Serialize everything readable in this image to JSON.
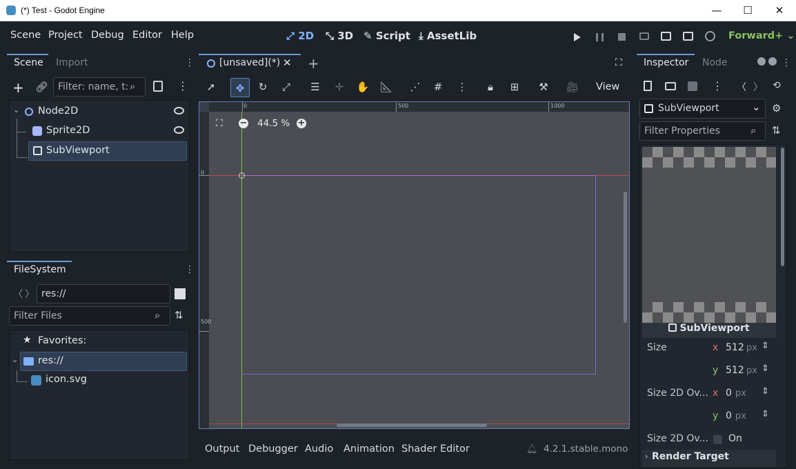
{
  "window": {
    "title": "(*) Test - Godot Engine",
    "minimize": "—",
    "maximize": "☐",
    "close": "✕"
  },
  "menu": {
    "items": [
      "Scene",
      "Project",
      "Debug",
      "Editor",
      "Help"
    ]
  },
  "workspaces": {
    "items": [
      {
        "icon": "⤢",
        "label": "2D"
      },
      {
        "icon": "⤡",
        "label": "3D"
      },
      {
        "icon": "✎",
        "label": "Script"
      },
      {
        "icon": "⤓",
        "label": "AssetLib"
      }
    ],
    "active": "2D"
  },
  "renderer": {
    "label": "Forward+",
    "chevron": "⌄",
    "color": "#89c35c"
  },
  "scene_dock": {
    "tabs": [
      "Scene",
      "Import"
    ],
    "filter_placeholder": "Filter: name, t:t",
    "tree": [
      {
        "name": "Node2D",
        "icon": "○",
        "icon_color": "#8fb3ff",
        "visible": true
      },
      {
        "name": "Sprite2D",
        "icon": "☺",
        "icon_color": "#a6b8ff",
        "visible": true
      },
      {
        "name": "SubViewport",
        "icon": "⊡",
        "icon_color": "#e0e4e8",
        "visible": false,
        "selected": true
      }
    ]
  },
  "filesystem": {
    "tab": "FileSystem",
    "path": "res://",
    "filter_placeholder": "Filter Files",
    "favorites_label": "Favorites:",
    "root": "res://",
    "files": [
      "icon.svg"
    ]
  },
  "editor": {
    "scene_tab": "[unsaved](*)",
    "view_menu": "View",
    "zoom": "44.5 %",
    "ruler_labels": {
      "h0": "0",
      "h500": "500",
      "h1000": "1000",
      "v0": "0",
      "v500": "500"
    }
  },
  "bottom_tabs": [
    "Output",
    "Debugger",
    "Audio",
    "Animation",
    "Shader Editor"
  ],
  "version": "4.2.1.stable.mono",
  "inspector": {
    "tabs": [
      "Inspector",
      "Node"
    ],
    "object": "SubViewport",
    "filter_placeholder": "Filter Properties",
    "preview_label": "SubViewport",
    "properties": [
      {
        "label": "Size",
        "axis": "x",
        "value": "512",
        "unit": "px"
      },
      {
        "label": "",
        "axis": "y",
        "value": "512",
        "unit": "px"
      },
      {
        "label": "Size 2D Ov...",
        "axis": "x",
        "value": "0",
        "unit": "px"
      },
      {
        "label": "",
        "axis": "y",
        "value": "0",
        "unit": "px"
      }
    ],
    "stretch": {
      "label": "Size 2D Ov...",
      "value": "On"
    },
    "section": "Render Target"
  }
}
